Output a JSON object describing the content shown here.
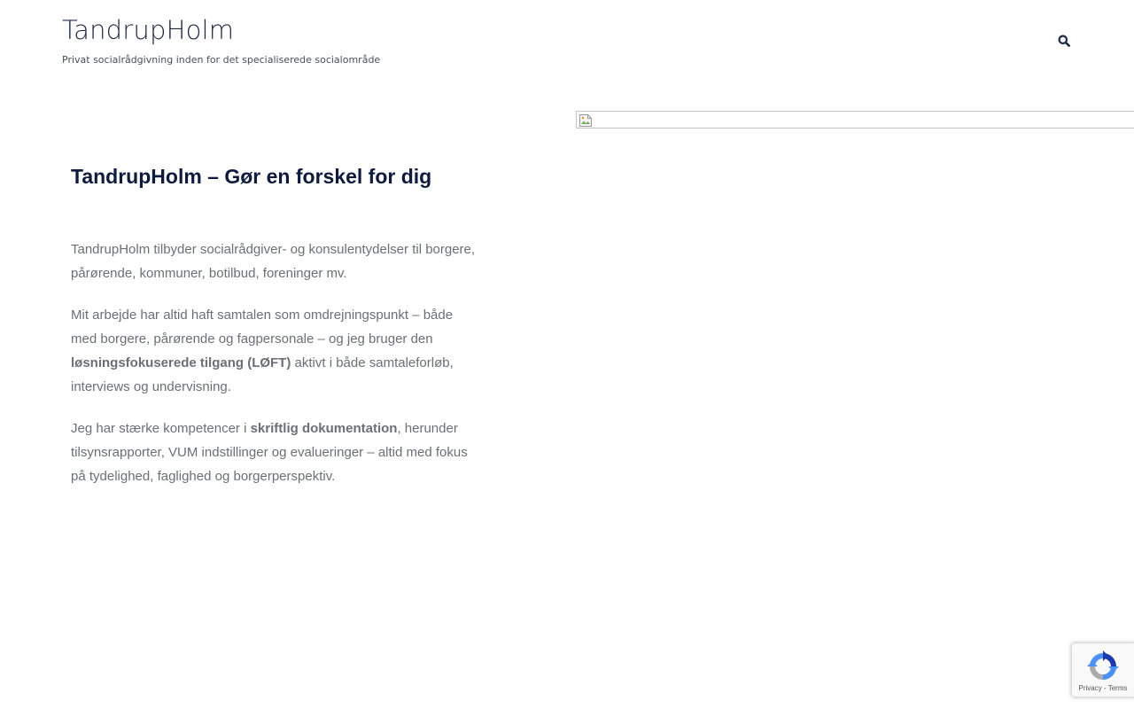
{
  "site": {
    "title": "TandrupHolm",
    "tagline": "Privat socialrådgivning inden for det specialiserede socialområde"
  },
  "header": {
    "search_icon": "search-icon"
  },
  "main": {
    "heading": "TandrupHolm – Gør en forskel for dig",
    "paragraphs": [
      {
        "text": "TandrupHolm tilbyder socialrådgiver- og konsulentydelser til borgere, pårørende, kommuner, botilbud, foreninger mv."
      },
      {
        "before": "Mit arbejde har altid haft samtalen som omdrejningspunkt – både med borgere, pårørende og fagpersonale – og jeg bruger den ",
        "strong": "løsningsfokuserede tilgang (LØFT)",
        "after": " aktivt i både samtaleforløb, interviews og undervisning."
      },
      {
        "before": "Jeg har stærke kompetencer i ",
        "strong": "skriftlig dokumentation",
        "after": ", herunder tilsynsrapporter, VUM indstillinger og evalueringer – altid med fokus på tydelighed, faglighed og borgerperspektiv."
      }
    ]
  },
  "hero_image": {
    "icon": "broken-image-icon"
  },
  "recaptcha": {
    "privacy": "Privacy",
    "separator": " - ",
    "terms": "Terms",
    "icon": "recaptcha-icon"
  },
  "colors": {
    "heading": "#0f1b3d",
    "body_text": "#6b6f76",
    "title": "#1f2a44"
  }
}
